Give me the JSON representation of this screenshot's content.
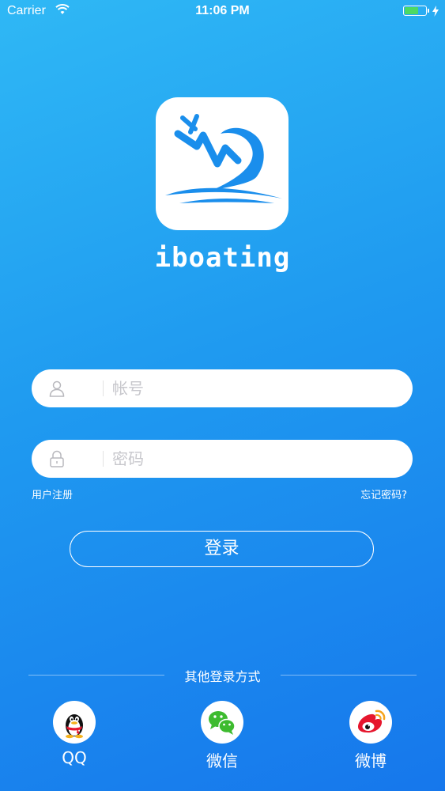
{
  "status_bar": {
    "carrier": "Carrier",
    "time": "11:06 PM",
    "battery_level": 0.6,
    "battery_color": "#4cd964"
  },
  "app": {
    "name": "iboating",
    "logo_icon": "boat-wave-logo"
  },
  "form": {
    "account_placeholder": "帐号",
    "account_icon": "user-icon",
    "password_placeholder": "密码",
    "password_icon": "lock-icon",
    "register_label": "用户注册",
    "forgot_label": "忘记密码?",
    "login_label": "登录"
  },
  "other_login": {
    "title": "其他登录方式",
    "items": [
      {
        "label": "QQ",
        "icon": "qq-penguin-icon"
      },
      {
        "label": "微信",
        "icon": "wechat-icon",
        "color": "#3dbb2f"
      },
      {
        "label": "微博",
        "icon": "weibo-icon",
        "color": "#e6162d"
      }
    ]
  },
  "colors": {
    "background_top": "#2fb8f5",
    "background_bottom": "#1677ec",
    "logo_blue": "#1a8eec"
  }
}
